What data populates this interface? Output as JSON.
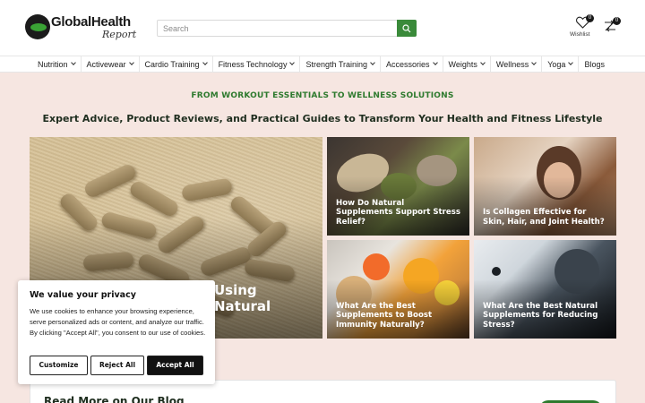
{
  "header": {
    "logo_text": "GlobalHealth",
    "logo_subtext": "Report",
    "search_placeholder": "Search",
    "wishlist_label": "Wishlist",
    "wishlist_count": "0",
    "compare_count": "0"
  },
  "nav": {
    "items": [
      {
        "label": "Nutrition",
        "dropdown": true
      },
      {
        "label": "Activewear",
        "dropdown": true
      },
      {
        "label": "Cardio Training",
        "dropdown": true
      },
      {
        "label": "Fitness Technology",
        "dropdown": true
      },
      {
        "label": "Strength Training",
        "dropdown": true
      },
      {
        "label": "Accessories",
        "dropdown": true
      },
      {
        "label": "Weights",
        "dropdown": true
      },
      {
        "label": "Wellness",
        "dropdown": true
      },
      {
        "label": "Yoga",
        "dropdown": true
      },
      {
        "label": "Blogs",
        "dropdown": false
      }
    ]
  },
  "hero": {
    "tagline": "FROM WORKOUT ESSENTIALS TO WELLNESS SOLUTIONS",
    "headline": "Expert Advice, Product Reviews, and Practical Guides to Transform Your Health and Fitness Lifestyle"
  },
  "articles": {
    "main": {
      "title": "Using Natural"
    },
    "a": {
      "title": "How Do Natural Supplements Support Stress Relief?"
    },
    "b": {
      "title": "Is Collagen Effective for Skin, Hair, and Joint Health?"
    },
    "c": {
      "title": "What Are the Best Supplements to Boost Immunity Naturally?"
    },
    "d": {
      "title": "What Are the Best Natural Supplements for Reducing Stress?"
    }
  },
  "blog": {
    "title": "Read More on Our Blog"
  },
  "cookie": {
    "title": "We value your privacy",
    "text": "We use cookies to enhance your browsing experience, serve personalized ads or content, and analyze our traffic. By clicking \"Accept All\", you consent to our use of cookies.",
    "customize": "Customize",
    "reject": "Reject All",
    "accept": "Accept All"
  },
  "colors": {
    "brand_green": "#2e7a2e",
    "page_bg": "#f6e6e1",
    "header_bg": "#ffffff"
  }
}
